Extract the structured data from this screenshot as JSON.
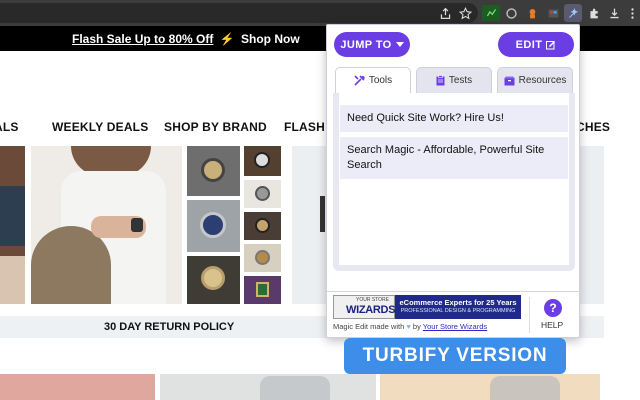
{
  "browser": {
    "icons": [
      "share-icon",
      "star-icon",
      "extension-icon",
      "extension-icon",
      "extension-icon",
      "extension-icon",
      "magic-edit-extension-icon",
      "puzzle-icon",
      "download-icon",
      "menu-icon"
    ]
  },
  "site": {
    "flash": {
      "text": "Flash Sale Up to 80% Off",
      "bolt": "⚡",
      "link": "Shop Now"
    },
    "nav": [
      "ALS",
      "WEEKLY DEALS",
      "SHOP BY BRAND",
      "FLASH S",
      "CHES"
    ],
    "return_policy": "30 DAY RETURN POLICY"
  },
  "popup": {
    "jump_to": "JUMP TO",
    "edit": "EDIT",
    "tabs": [
      {
        "label": "Tools",
        "icon": "tools-icon",
        "active": true
      },
      {
        "label": "Tests",
        "icon": "clipboard-icon",
        "active": false
      },
      {
        "label": "Resources",
        "icon": "box-icon",
        "active": false
      }
    ],
    "items": [
      "Need Quick Site Work? Hire Us!",
      "Search Magic - Affordable, Powerful Site Search"
    ],
    "banner": {
      "logo_small": "YOUR STORE",
      "logo": "WIZARDS",
      "line1": "eCommerce Experts for 25 Years",
      "line2": "PROFESSIONAL DESIGN & PROGRAMMING"
    },
    "made_with": {
      "prefix": "Magic Edit made with",
      "by": "by",
      "link": "Your Store Wizards"
    },
    "help": "HELP",
    "help_symbol": "?"
  },
  "badge": "TURBIFY VERSION",
  "colors": {
    "accent": "#6a3ee3",
    "turbify": "#3d8ee9",
    "toolbar": "#3c3c3c"
  }
}
